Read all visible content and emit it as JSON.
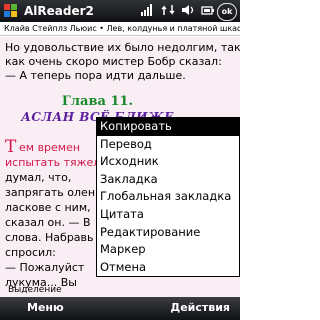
{
  "titlebar": {
    "title": "AlReader2",
    "ok_label": "ok",
    "logo_colors": [
      "#e63b2e",
      "#5cb531",
      "#1e7bd6",
      "#f5c21b"
    ],
    "icons": [
      "signal-icon",
      "network-icon",
      "volume-icon",
      "battery-icon"
    ]
  },
  "reader": {
    "header": "Клайв Стейплз Льюис • Лев, колдунья и платяной шкаф",
    "lines": [
      "Но удовольствие их было недолгим, так",
      "как очень скоро мистер Бобр сказал:",
      "— А теперь пора идти дальше."
    ],
    "chapter_number": "Глава 11.",
    "chapter_title": "АСЛАН ВСЁ БЛИЖЕ",
    "dropcap": "Т",
    "paragraph_first_line": "ем времен",
    "paragraph_lines": [
      "испытать тяжел",
      "думал,  что,",
      "запрягать олен",
      "ласкове с ним,",
      "сказал он. — В",
      "слова. Набравь",
      "спросил:",
      "— Пожалуйст",
      "лукума... Вы"
    ],
    "colors": {
      "page_background": "#f9eef4",
      "highlight": "#d2184a",
      "chapter_number": "#1a8a2a",
      "chapter_title": "#5a1f9c"
    }
  },
  "context_menu": {
    "selected_index": 0,
    "items": [
      "Копировать",
      "Перевод",
      "Исходник",
      "Закладка",
      "Глобальная закладка",
      "Цитата",
      "Редактирование",
      "Маркер",
      "Отмена"
    ]
  },
  "selection_label": "Выделение",
  "softkeys": {
    "left": "Меню",
    "right": "Действия"
  }
}
